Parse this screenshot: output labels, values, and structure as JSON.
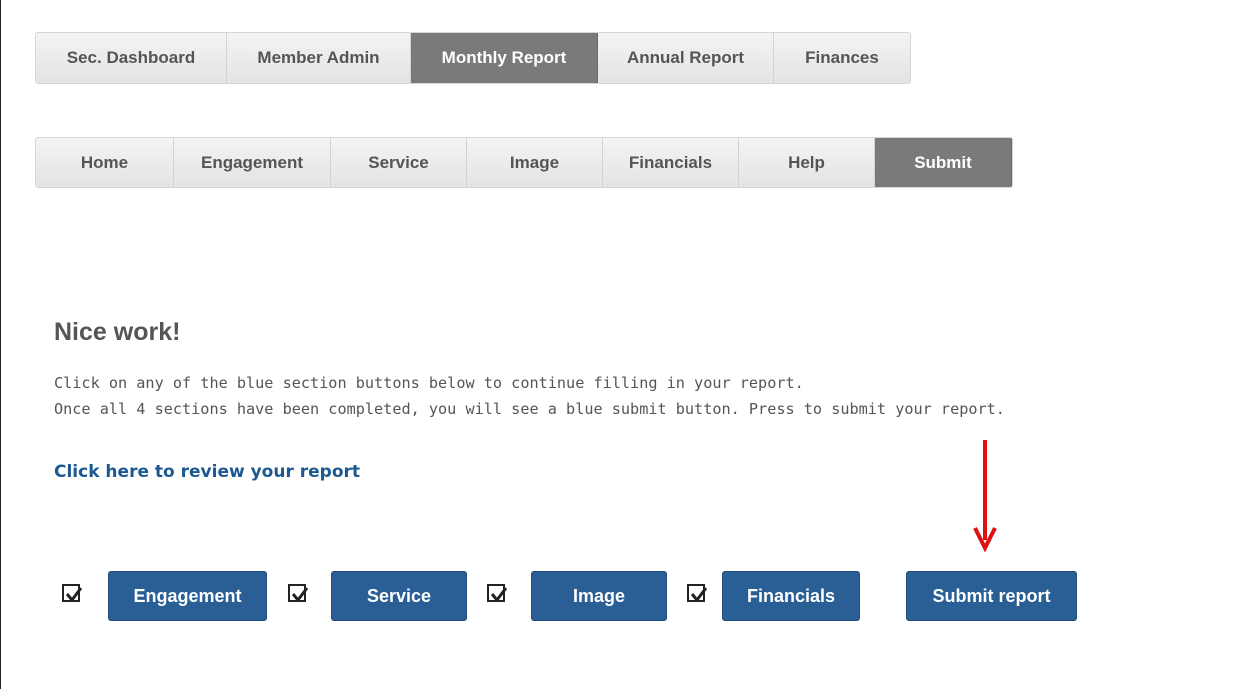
{
  "main_nav": {
    "tabs": [
      {
        "label": "Sec. Dashboard",
        "active": false
      },
      {
        "label": "Member Admin",
        "active": false
      },
      {
        "label": "Monthly Report",
        "active": true
      },
      {
        "label": "Annual Report",
        "active": false
      },
      {
        "label": "Finances",
        "active": false
      }
    ]
  },
  "sub_nav": {
    "tabs": [
      {
        "label": "Home",
        "active": false
      },
      {
        "label": "Engagement",
        "active": false
      },
      {
        "label": "Service",
        "active": false
      },
      {
        "label": "Image",
        "active": false
      },
      {
        "label": "Financials",
        "active": false
      },
      {
        "label": "Help",
        "active": false
      },
      {
        "label": "Submit",
        "active": true
      }
    ]
  },
  "content": {
    "heading": "Nice work!",
    "line1": "Click on any of the blue section buttons below to continue filling in your report.",
    "line2": "Once all 4 sections have been completed, you will see a blue submit button. Press to submit your report.",
    "review_link": "Click here to review your report"
  },
  "sections": [
    {
      "label": "Engagement",
      "checked": true
    },
    {
      "label": "Service",
      "checked": true
    },
    {
      "label": "Image",
      "checked": true
    },
    {
      "label": "Financials",
      "checked": true
    }
  ],
  "submit_button": {
    "label": "Submit report"
  },
  "colors": {
    "primary_button": "#2a5f96",
    "active_tab": "#7a7a7a",
    "link": "#1c5891",
    "annotation_arrow": "#e01010"
  },
  "icons": {
    "checkbox": "checkbox-checked-icon",
    "annotation": "arrow-down-icon"
  }
}
